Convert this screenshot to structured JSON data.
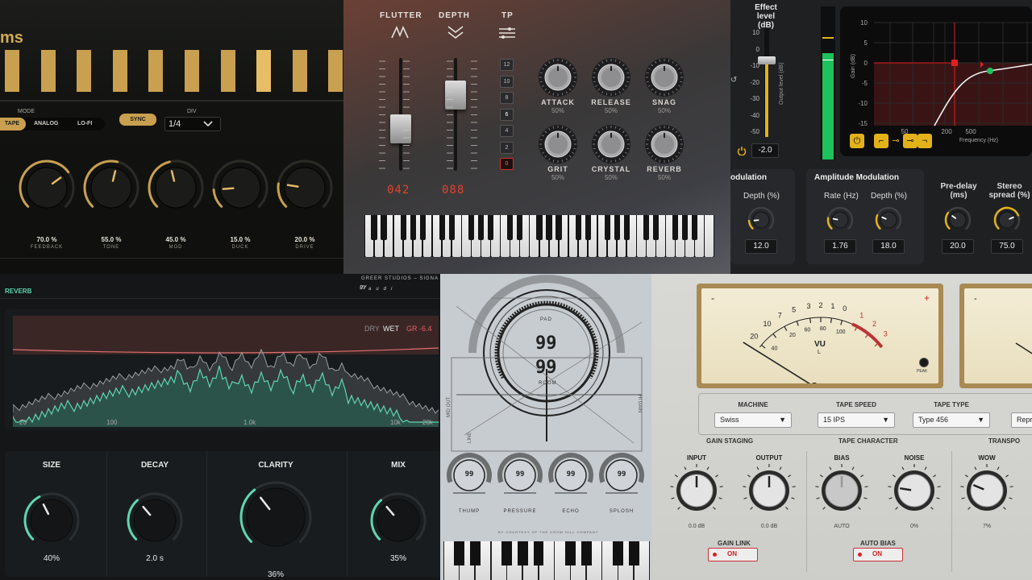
{
  "delay": {
    "title": "ms",
    "mode_label": "MODE",
    "modes": [
      "TAPE",
      "ANALOG",
      "LO-FI"
    ],
    "sync_label": "SYNC",
    "div_label": "DIV",
    "div_value": "1/4",
    "knobs": [
      {
        "value": "70.0 %",
        "name": "FEEDBACK",
        "level": 0.7
      },
      {
        "value": "55.0 %",
        "name": "TONE",
        "level": 0.55
      },
      {
        "value": "45.0 %",
        "name": "MOD",
        "level": 0.45
      },
      {
        "value": "15.0 %",
        "name": "DUCK",
        "level": 0.15
      },
      {
        "value": "20.0 %",
        "name": "DRIVE",
        "level": 0.2
      }
    ],
    "steps": [
      true,
      true,
      true,
      true,
      true,
      true,
      true,
      true,
      true,
      true
    ],
    "accent": "#c9a04f"
  },
  "tape": {
    "flutter_label": "FLUTTER",
    "depth_label": "DEPTH",
    "tp_label": "TP",
    "flutter_readout": "042",
    "depth_readout": "088",
    "tp_steps": [
      "12",
      "10",
      "8",
      "6",
      "4",
      "2",
      "0"
    ],
    "tp_active": "0",
    "knobs": [
      {
        "name": "ATTACK",
        "value": "50%"
      },
      {
        "name": "RELEASE",
        "value": "50%"
      },
      {
        "name": "SNAG",
        "value": "50%"
      },
      {
        "name": "GRIT",
        "value": "50%"
      },
      {
        "name": "CRYSTAL",
        "value": "50%"
      },
      {
        "name": "REVERB",
        "value": "50%"
      }
    ]
  },
  "mod": {
    "effect_level_label": "Effect level (dB)",
    "effect_level_value": "-2.0",
    "scale": [
      "10",
      "0",
      "-10",
      "-20",
      "-30",
      "-40",
      "-50"
    ],
    "output_level_label": "Output level (dB)",
    "eq": {
      "y_label": "Gain (dB)",
      "x_label": "Frequency (Hz)",
      "y_ticks": [
        "10",
        "5",
        "0",
        "-5",
        "-10",
        "-15"
      ],
      "x_ticks": [
        "50",
        "200",
        "500"
      ]
    },
    "left_group": "odulation",
    "left_knob": {
      "label": "Depth (%)",
      "value": "12.0"
    },
    "amp_group": "Amplitude Modulation",
    "amp_knobs": [
      {
        "label": "Rate (Hz)",
        "value": "1.76"
      },
      {
        "label": "Depth (%)",
        "value": "18.0"
      }
    ],
    "right_knobs": [
      {
        "label": "Pre-delay (ms)",
        "value": "20.0"
      },
      {
        "label": "Stereo spread (%)",
        "value": "75.0"
      }
    ]
  },
  "reverb": {
    "title": "REVERB",
    "brand": "GREER STUDIOS  –  SIGNA",
    "dry": "DRY",
    "wet": "WET",
    "gr": "GR -6.4",
    "freq_ticks": [
      "20",
      "100",
      "1.0k",
      "10k",
      "20k"
    ],
    "knobs": [
      {
        "name": "SIZE",
        "value": "40%",
        "level": 0.4
      },
      {
        "name": "DECAY",
        "value": "2.0 s",
        "level": 0.35
      },
      {
        "name": "CLARITY",
        "value": "36%",
        "level": 0.36
      },
      {
        "name": "MIX",
        "value": "35%",
        "level": 0.35
      }
    ],
    "accent": "#5fd6b0"
  },
  "sketch": {
    "pad_label": "PAD",
    "room_label": "ROOM",
    "pad_value": "99",
    "room_value": "99",
    "side_left": "MID OUT",
    "side_left2": "LINE",
    "side_right": "HI GAIN",
    "knobs": [
      {
        "name": "THUMP",
        "value": "99"
      },
      {
        "name": "PRESSURE",
        "value": "99"
      },
      {
        "name": "ECHO",
        "value": "99"
      },
      {
        "name": "SPLOSH",
        "value": "99"
      }
    ],
    "credit": "BY COURTESY OF THE CROW HILL COMPANY"
  },
  "machine": {
    "vu_label": "VU",
    "vu_channel": "L",
    "peak_label": "PEAK",
    "vu_scale": [
      "20",
      "10",
      "7",
      "5",
      "3",
      "2",
      "1",
      "0",
      "1",
      "2",
      "3"
    ],
    "vu_sub": [
      "40",
      "20",
      "60",
      "80",
      "100"
    ],
    "selects": [
      {
        "label": "MACHINE",
        "value": "Swiss"
      },
      {
        "label": "TAPE SPEED",
        "value": "15 IPS"
      },
      {
        "label": "TAPE TYPE",
        "value": "Type 456"
      },
      {
        "label": "S",
        "value": "Repr"
      }
    ],
    "sections": [
      "GAIN STAGING",
      "TAPE CHARACTER",
      "TRANSPO"
    ],
    "knobs": [
      {
        "name": "INPUT",
        "value": "0.0 dB"
      },
      {
        "name": "OUTPUT",
        "value": "0.0 dB"
      },
      {
        "name": "BIAS",
        "value": "AUTO"
      },
      {
        "name": "NOISE",
        "value": "0%"
      },
      {
        "name": "WOW",
        "value": "7%"
      }
    ],
    "gain_link": "GAIN LINK",
    "auto_bias": "AUTO BIAS",
    "on": "ON"
  }
}
